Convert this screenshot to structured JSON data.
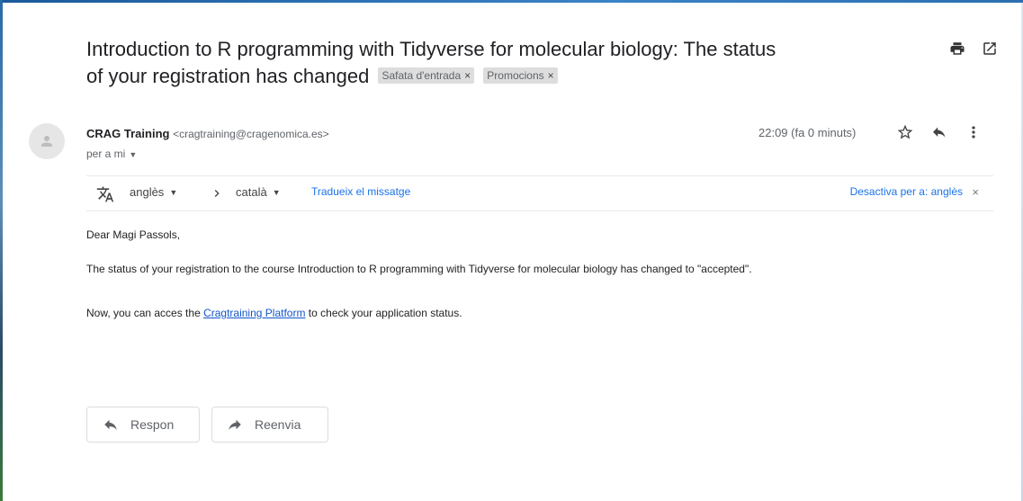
{
  "subject": {
    "line1": "Introduction to R programming with Tidyverse for molecular biology: The status",
    "line2": "of your registration has changed",
    "labels": [
      {
        "text": "Safata d'entrada",
        "remove": "×"
      },
      {
        "text": "Promocions",
        "remove": "×"
      }
    ],
    "icons": [
      "print-icon",
      "open-in-new-window-icon"
    ]
  },
  "sender": {
    "name": "CRAG Training",
    "email": "<cragtraining@cragenomica.es>",
    "to": "per a mi",
    "timestamp": "22:09 (fa 0 minuts)",
    "actions": [
      "star-icon",
      "reply-icon",
      "more-options-icon"
    ]
  },
  "translate_bar": {
    "from_language": "anglès",
    "to_language": "català",
    "translate_link": "Tradueix el missatge",
    "disable_link": "Desactiva per a: anglès",
    "close": "×"
  },
  "body": {
    "greeting": "Dear Magi Passols,",
    "paragraph1": "The status of your registration to the course Introduction to R programming with Tidyverse for molecular biology has changed to \"accepted\".",
    "paragraph2_before": "Now, you can acces the ",
    "paragraph2_link": "Cragtraining Platform",
    "paragraph2_after": " to check your application status."
  },
  "buttons": {
    "reply": "Respon",
    "forward": "Reenvia"
  },
  "colors": {
    "link": "#1a73e8",
    "body_link": "#1155cc",
    "label_chip_bg": "#dddddd",
    "muted_text": "#5f6368"
  }
}
